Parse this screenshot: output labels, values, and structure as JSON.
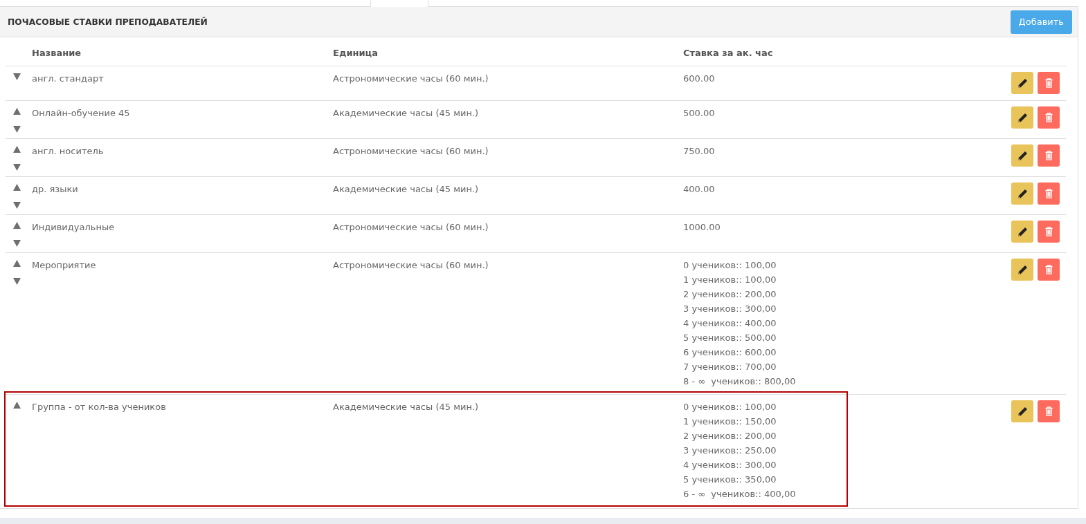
{
  "panel": {
    "title": "ПОЧАСОВЫЕ СТАВКИ ПРЕПОДАВАТЕЛЕЙ",
    "add_button": "Добавить"
  },
  "table": {
    "columns": [
      "Название",
      "Единица",
      "Ставка за ак. час"
    ],
    "rows": [
      {
        "name": "англ. стандарт",
        "unit": "Астрономические часы (60 мин.)",
        "rate": [
          "600.00"
        ],
        "can_move_up": false,
        "can_move_down": true,
        "highlighted": false
      },
      {
        "name": "Онлайн-обучение 45",
        "unit": "Академические часы (45 мин.)",
        "rate": [
          "500.00"
        ],
        "can_move_up": true,
        "can_move_down": true,
        "highlighted": false
      },
      {
        "name": "англ. носитель",
        "unit": "Астрономические часы (60 мин.)",
        "rate": [
          "750.00"
        ],
        "can_move_up": true,
        "can_move_down": true,
        "highlighted": false
      },
      {
        "name": "др. языки",
        "unit": "Академические часы (45 мин.)",
        "rate": [
          "400.00"
        ],
        "can_move_up": true,
        "can_move_down": true,
        "highlighted": false
      },
      {
        "name": "Индивидуальные",
        "unit": "Астрономические часы (60 мин.)",
        "rate": [
          "1000.00"
        ],
        "can_move_up": true,
        "can_move_down": true,
        "highlighted": false
      },
      {
        "name": "Мероприятие",
        "unit": "Астрономические часы (60 мин.)",
        "rate": [
          "0 учеников:: 100,00",
          "1 учеников:: 100,00",
          "2 учеников:: 200,00",
          "3 учеников:: 300,00",
          "4 учеников:: 400,00",
          "5 учеников:: 500,00",
          "6 учеников:: 600,00",
          "7 учеников:: 700,00",
          "8 - ∞  учеников:: 800,00"
        ],
        "can_move_up": true,
        "can_move_down": true,
        "highlighted": false
      },
      {
        "name": "Группа - от кол-ва учеников",
        "unit": "Академические часы (45 мин.)",
        "rate": [
          "0 учеников:: 100,00",
          "1 учеников:: 150,00",
          "2 учеников:: 200,00",
          "3 учеников:: 250,00",
          "4 учеников:: 300,00",
          "5 учеников:: 350,00",
          "6 - ∞  учеников:: 400,00"
        ],
        "can_move_up": true,
        "can_move_down": false,
        "highlighted": true
      }
    ]
  }
}
